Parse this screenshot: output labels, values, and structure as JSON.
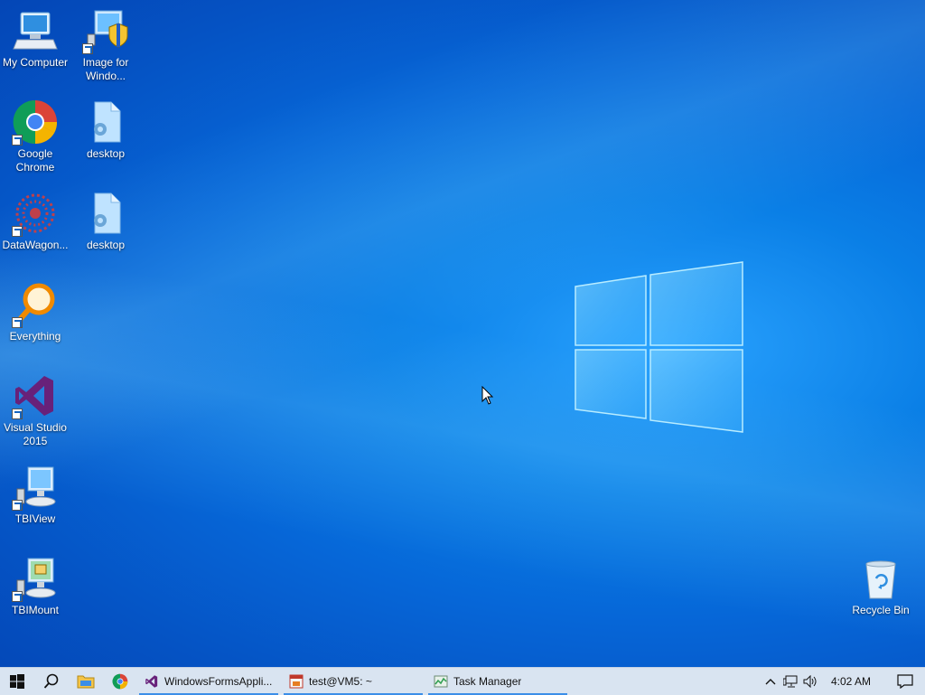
{
  "desktop": {
    "icons": [
      {
        "label": "My Computer",
        "icon": "computer-icon"
      },
      {
        "label": "Image for Windo...",
        "icon": "image-for-windows-icon"
      },
      {
        "label": "Google Chrome",
        "icon": "chrome-icon"
      },
      {
        "label": "desktop",
        "icon": "config-file-icon"
      },
      {
        "label": "DataWagon...",
        "icon": "datawagon-icon"
      },
      {
        "label": "desktop",
        "icon": "config-file-icon"
      },
      {
        "label": "Everything",
        "icon": "everything-search-icon"
      },
      {
        "label": "Visual Studio 2015",
        "icon": "visual-studio-icon"
      },
      {
        "label": "TBIView",
        "icon": "tbiview-icon"
      },
      {
        "label": "TBIMount",
        "icon": "tbimount-icon"
      },
      {
        "label": "Recycle Bin",
        "icon": "recycle-bin-icon"
      }
    ]
  },
  "taskbar": {
    "pinned": [
      "start-icon",
      "search-icon",
      "file-explorer-icon",
      "chrome-icon"
    ],
    "tasks": [
      {
        "label": "WindowsFormsAppli...",
        "icon": "visual-studio-icon"
      },
      {
        "label": "test@VM5: ~",
        "icon": "terminal-icon"
      },
      {
        "label": "Task Manager",
        "icon": "task-manager-icon"
      }
    ],
    "tray": {
      "icons": [
        "chevron-up-icon",
        "network-icon",
        "volume-icon"
      ],
      "time": "4:02 AM"
    },
    "notification_icon": "action-center-icon"
  },
  "colors": {
    "accent": "#0a7fe6",
    "taskbar_bg": "#d9e4f1",
    "task_underline": "#3b8ee8"
  }
}
